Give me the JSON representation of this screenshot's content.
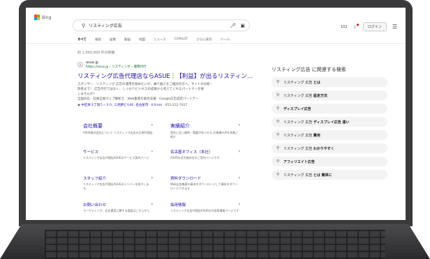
{
  "header": {
    "brand": "Bing",
    "search_query": "リスティング広告",
    "points": "102",
    "login_label": "ログイン"
  },
  "tabs": [
    "すべて",
    "検索",
    "画像",
    "動画",
    "地図",
    "ニュース",
    "COPILOT",
    "さらに表示",
    "ツール"
  ],
  "result_count": "約 1,000,000 件の検索",
  "main_result": {
    "favicon_letter": "A",
    "site_name": "asue.jp",
    "site_url": "https://asue.jp › リスティング › 運用代行",
    "title": "リスティング広告代理店ならASUE｜【利益】が出るリスティン…",
    "snippet_lines": [
      "スポンサー · リスティング 広告の運用を始めたいが、乗り換えをご検討の方へ。サイトの分析・",
      "改善まで！ 広告代行ではなく、しっかりビジネスの成果から考えてくれるパートナーを探",
      "しませんか？",
      "全国対応 · 社員全員ウェブ解析士 · Web集客を総合支援 · Google広告認定パートナー"
    ],
    "address_link": "中区栄３丁目５−３０, 三見野ビル6F, 名古屋市 · 0.9 km",
    "address_phone": "· 052-212-7017"
  },
  "sitelinks": [
    {
      "title": "会社概要",
      "desc": "ASUE株式会社について リスティング広告の正規代理店"
    },
    {
      "title": "実績紹介",
      "desc": "貴社に近い事例・実績が見つかる お客様の声を多数ご紹介"
    },
    {
      "title": "サービス",
      "desc": "リスティング広告代理店ASUEのサービス案内ページ"
    },
    {
      "title": "名古屋オフィス（本社）",
      "desc": "ASUE社名古屋本社のご案内ページです"
    },
    {
      "title": "スタッフ紹介",
      "desc": "リスティング広告代理店ASUEのメンバーを紹介します。"
    },
    {
      "title": "資料ダウンロード",
      "desc": "Web広告集客の基本をダウンロードして資料をダウンロードできます"
    },
    {
      "title": "お問い合わせ",
      "desc": "マーケティング、広告運用に関する相談はこちらから"
    },
    {
      "title": "採用情報",
      "desc": "リスティング広告代理店ASUE社の採用情報ページです"
    }
  ],
  "related": {
    "title": "リスティング広告 に関連する検索",
    "items": [
      {
        "prefix": "リスティング 広告",
        "bold": "とは"
      },
      {
        "prefix": "リスティング 広告",
        "bold": "設定方法"
      },
      {
        "prefix": "",
        "bold": "ディスプレイ広告"
      },
      {
        "prefix": "リスティング 広告",
        "bold": "ディスプレイ広告 違い"
      },
      {
        "prefix": "リスティング 広告",
        "bold": "費用"
      },
      {
        "prefix": "リスティング 広告",
        "bold": "わかりやすく"
      },
      {
        "prefix": "",
        "bold": "アフィリエイト広告"
      },
      {
        "prefix": "リスティング 広告",
        "bold": "とは 簡単に"
      }
    ]
  },
  "colors": {
    "link": "#1a0dab",
    "url_green": "#006621",
    "frame": "#3a3a3c"
  }
}
